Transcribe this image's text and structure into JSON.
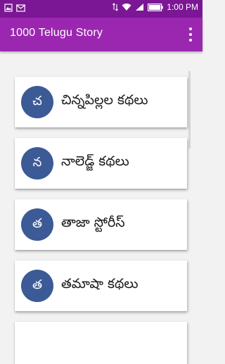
{
  "status_bar": {
    "time": "1:00 PM"
  },
  "app_bar": {
    "title": "1000 Telugu Story"
  },
  "items": [
    {
      "letter": "చ",
      "label": "చిన్నపిల్లల కథలు"
    },
    {
      "letter": "న",
      "label": "నాలెడ్జ్ కథలు"
    },
    {
      "letter": "త",
      "label": "తాజా స్టోరీస్"
    },
    {
      "letter": "త",
      "label": "తమాషా కథలు"
    }
  ],
  "colors": {
    "status_bar": "#7b1794",
    "app_bar": "#9b27b0",
    "avatar": "#3b5a96",
    "background": "#f2f2f2"
  }
}
